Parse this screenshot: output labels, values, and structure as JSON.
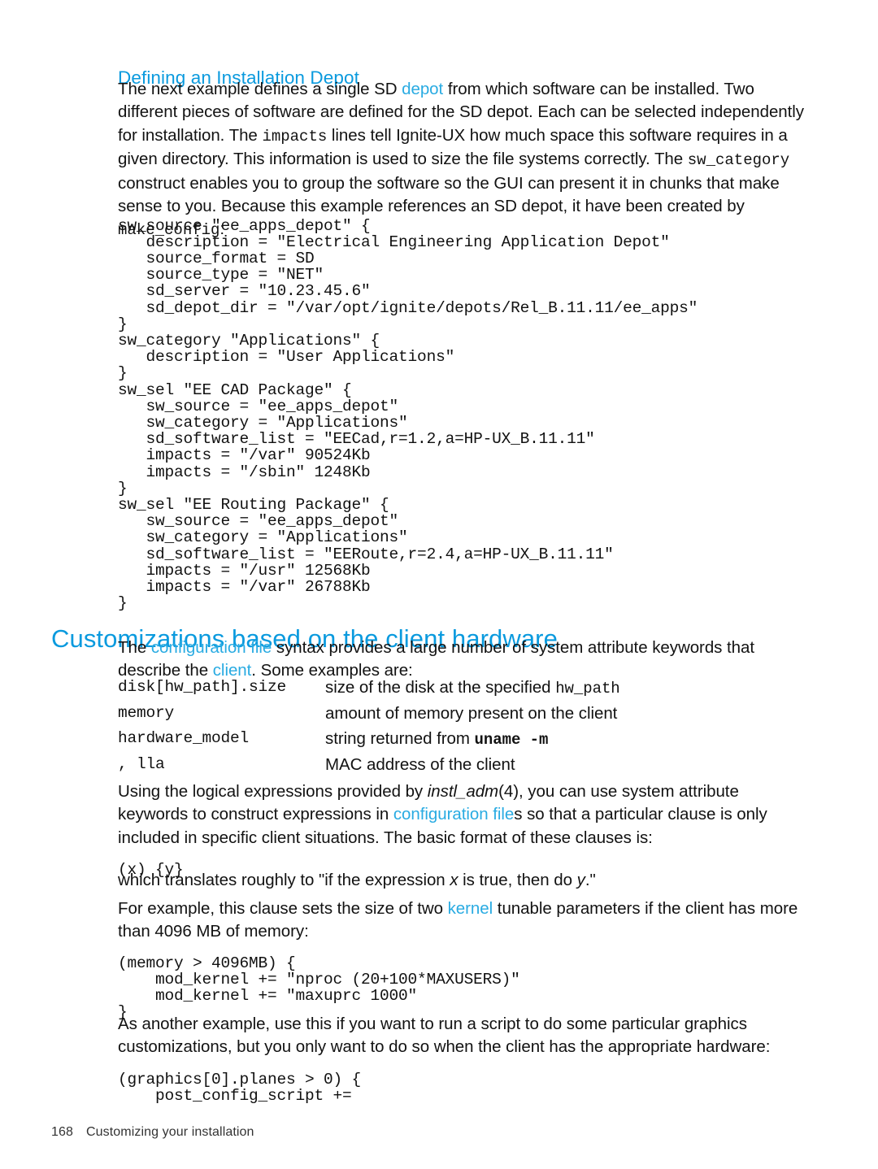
{
  "document": {
    "page_number": "168",
    "footer_title": "Customizing your installation",
    "accent_color": "#0a9ade",
    "link_color": "#29abe2"
  },
  "sections": {
    "depot": {
      "heading": "Defining an Installation Depot",
      "intro": {
        "p1": "The next example defines a single SD ",
        "link1": "depot",
        "p2": " from which software can be installed. Two different pieces of software are defined for the SD depot. Each can be selected independently for installation. The ",
        "code1": "impacts",
        "p3": " lines tell Ignite-UX how much space this software requires in a given directory. This information is used to size the file systems correctly. The ",
        "code2": "sw_category",
        "p4": " construct enables you to group the software so the GUI can present it in chunks that make sense to you. Because this example references an SD depot, it have been created by ",
        "code3": "make_config",
        "p5": ":"
      },
      "code_block": "sw_source \"ee_apps_depot\" {\n   description = \"Electrical Engineering Application Depot\"\n   source_format = SD\n   source_type = \"NET\"\n   sd_server = \"10.23.45.6\"\n   sd_depot_dir = \"/var/opt/ignite/depots/Rel_B.11.11/ee_apps\"\n}\nsw_category \"Applications\" {\n   description = \"User Applications\"\n}\nsw_sel \"EE CAD Package\" {\n   sw_source = \"ee_apps_depot\"\n   sw_category = \"Applications\"\n   sd_software_list = \"EECad,r=1.2,a=HP-UX_B.11.11\"\n   impacts = \"/var\" 90524Kb\n   impacts = \"/sbin\" 1248Kb\n}\nsw_sel \"EE Routing Package\" {\n   sw_source = \"ee_apps_depot\"\n   sw_category = \"Applications\"\n   sd_software_list = \"EERoute,r=2.4,a=HP-UX_B.11.11\"\n   impacts = \"/usr\" 12568Kb\n   impacts = \"/var\" 26788Kb\n}"
    },
    "customizations": {
      "heading": "Customizations based on the client hardware",
      "intro": {
        "p1": "The ",
        "link1": "configuration file",
        "p2": " syntax provides a large number of system attribute keywords that describe the ",
        "link2": "client",
        "p3": ". Some examples are:"
      },
      "attribute_table": [
        {
          "term": "disk[hw_path].size",
          "desc_pre": "size of the disk at the specified ",
          "desc_code": "hw_path",
          "desc_post": ""
        },
        {
          "term": "memory",
          "desc_pre": "amount of memory present on the client",
          "desc_code": "",
          "desc_post": ""
        },
        {
          "term": "hardware_model",
          "desc_pre": "string returned from ",
          "desc_code": "uname -m",
          "desc_post": ""
        },
        {
          "term": ", lla",
          "desc_pre": "MAC address of the client",
          "desc_code": "",
          "desc_post": ""
        }
      ],
      "expressions": {
        "p1": "Using the logical expressions provided by ",
        "italic1": "instl_adm",
        "p2": "(4), you can use system attribute keywords to construct expressions in ",
        "link1": "configuration file",
        "p3": "s so that a particular clause is only included in specific client situations. The basic format of these clauses is:"
      },
      "clause_format": "(x) {y}",
      "translation": {
        "p1": "which translates roughly to \"if the expression ",
        "italic1": "x",
        "p2": " is true, then do ",
        "italic2": "y",
        "p3": ".\""
      },
      "kernel_example": {
        "p1": "For example, this clause sets the size of two ",
        "link1": "kernel",
        "p2": " tunable parameters if the client has more than 4096 MB of memory:"
      },
      "kernel_code": "(memory > 4096MB) {\n    mod_kernel += \"nproc (20+100*MAXUSERS)\"\n    mod_kernel += \"maxuprc 1000\"\n}",
      "graphics_example": "As another example, use this if you want to run a script to do some particular graphics customizations, but you only want to do so when the client has the appropriate hardware:",
      "graphics_code": "(graphics[0].planes > 0) {\n    post_config_script +="
    }
  }
}
